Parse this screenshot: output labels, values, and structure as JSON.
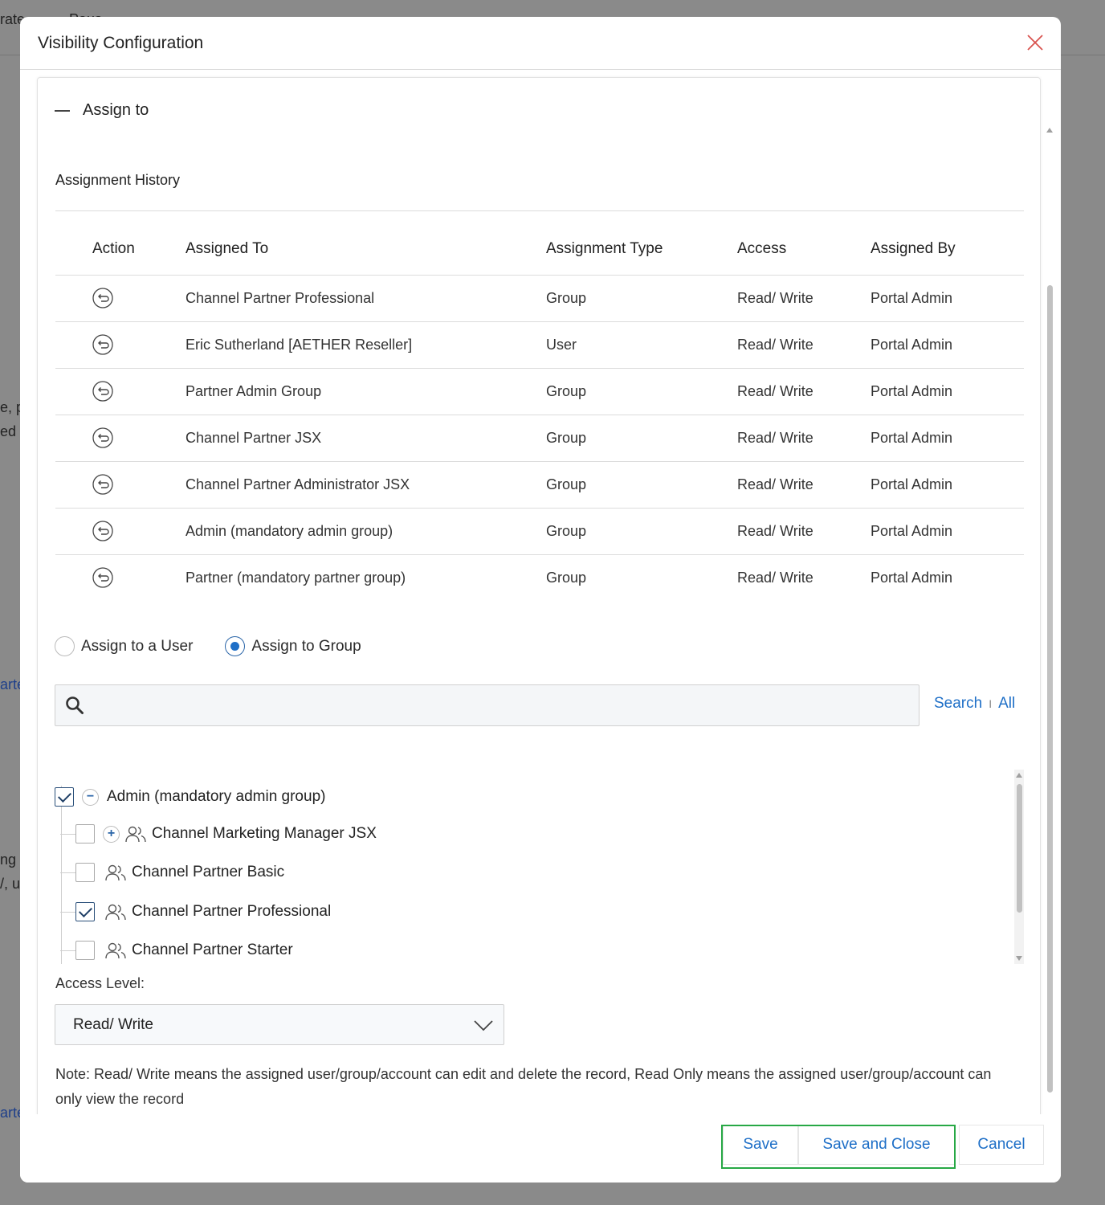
{
  "background": {
    "fragments": [
      "rate",
      "Paus",
      "e, p",
      "ed c",
      "arte",
      "ng",
      "/, us",
      "arte"
    ]
  },
  "modal": {
    "title": "Visibility Configuration",
    "close_icon": "close-icon"
  },
  "section": {
    "title": "Assign to",
    "history_title": "Assignment History",
    "columns": [
      "Action",
      "Assigned To",
      "Assignment Type",
      "Access",
      "Assigned By"
    ],
    "rows": [
      {
        "assigned_to": "Channel Partner Professional",
        "type": "Group",
        "access": "Read/ Write",
        "by": "Portal Admin"
      },
      {
        "assigned_to": "Eric Sutherland [AETHER Reseller]",
        "type": "User",
        "access": "Read/ Write",
        "by": "Portal Admin"
      },
      {
        "assigned_to": "Partner Admin Group",
        "type": "Group",
        "access": "Read/ Write",
        "by": "Portal Admin"
      },
      {
        "assigned_to": "Channel Partner JSX",
        "type": "Group",
        "access": "Read/ Write",
        "by": "Portal Admin"
      },
      {
        "assigned_to": "Channel Partner Administrator JSX",
        "type": "Group",
        "access": "Read/ Write",
        "by": "Portal Admin"
      },
      {
        "assigned_to": "Admin (mandatory admin group)",
        "type": "Group",
        "access": "Read/ Write",
        "by": "Portal Admin"
      },
      {
        "assigned_to": "Partner (mandatory partner group)",
        "type": "Group",
        "access": "Read/ Write",
        "by": "Portal Admin"
      }
    ]
  },
  "assign_mode": {
    "user_label": "Assign to a User",
    "group_label": "Assign to Group",
    "selected": "group"
  },
  "search": {
    "value": "",
    "placeholder": "",
    "search_link": "Search",
    "separator": "I",
    "all_link": "All"
  },
  "tree": {
    "root": {
      "label": "Admin (mandatory admin group)",
      "checked": true
    },
    "children": [
      {
        "label": "Channel Marketing Manager JSX",
        "checked": false,
        "expandable": true
      },
      {
        "label": "Channel Partner Basic",
        "checked": false
      },
      {
        "label": "Channel Partner Professional",
        "checked": true
      },
      {
        "label": "Channel Partner Starter",
        "checked": false
      }
    ]
  },
  "access_level": {
    "label": "Access Level:",
    "value": "Read/ Write"
  },
  "note": "Note: Read/ Write means the assigned user/group/account can edit and delete the record, Read Only means the assigned user/group/account can only view the record",
  "footer": {
    "save": "Save",
    "save_close": "Save and Close",
    "cancel": "Cancel"
  },
  "colors": {
    "link": "#1e6fc7",
    "highlight": "#27a845",
    "close": "#d9534f"
  }
}
